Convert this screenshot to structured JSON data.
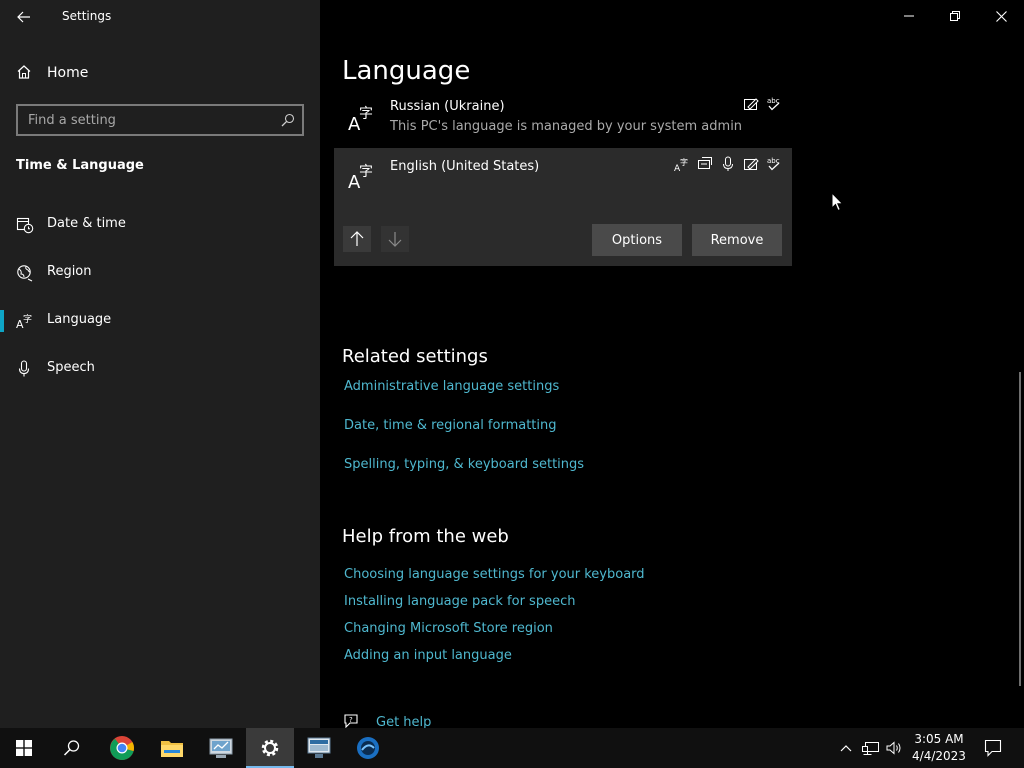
{
  "window": {
    "title": "Settings",
    "back_icon": "back-arrow-icon",
    "controls": [
      "minimize-icon",
      "restore-icon",
      "close-icon"
    ]
  },
  "sidebar": {
    "home_label": "Home",
    "search": {
      "placeholder": "Find a setting",
      "value": ""
    },
    "section_title": "Time & Language",
    "items": [
      {
        "label": "Date & time",
        "icon": "clock-calendar-icon",
        "active": false
      },
      {
        "label": "Region",
        "icon": "globe-icon",
        "active": false
      },
      {
        "label": "Language",
        "icon": "language-icon",
        "active": true
      },
      {
        "label": "Speech",
        "icon": "microphone-icon",
        "active": false
      }
    ]
  },
  "main": {
    "title": "Language",
    "languages": [
      {
        "name": "Russian (Ukraine)",
        "sub": "This PC's language is managed by your system admin",
        "features": [
          "handwriting-icon",
          "spellcheck-icon"
        ]
      },
      {
        "name": "English (United States)",
        "sub": "",
        "features": [
          "display-language-icon",
          "text-to-speech-icon",
          "speech-recognition-icon",
          "handwriting-icon",
          "spellcheck-icon"
        ],
        "options_label": "Options",
        "remove_label": "Remove"
      }
    ],
    "related_title": "Related settings",
    "related_links": [
      "Administrative language settings",
      "Date, time & regional formatting",
      "Spelling, typing, & keyboard settings"
    ],
    "help_title": "Help from the web",
    "help_links": [
      "Choosing language settings for your keyboard",
      "Installing language pack for speech",
      "Changing Microsoft Store region",
      "Adding an input language"
    ],
    "get_help_label": "Get help"
  },
  "taskbar": {
    "apps": [
      "windows-start-icon",
      "search-icon",
      "chrome-icon",
      "file-explorer-icon",
      "computer-management-icon",
      "settings-gear-icon",
      "remote-desktop-icon",
      "app-circle-icon"
    ],
    "active_app": "settings-gear-icon",
    "tray": [
      "show-hidden-icons-chevron",
      "network-icon",
      "volume-icon"
    ],
    "time": "3:05 AM",
    "date": "4/4/2023",
    "notification_icon": "action-center-icon"
  },
  "colors": {
    "sidebar_bg": "#1f1f1f",
    "main_bg": "#000000",
    "link": "#4fb8cf",
    "accent": "#0ea5c6",
    "selected_row": "#2b2b2b",
    "taskbar_bg": "#101010"
  }
}
